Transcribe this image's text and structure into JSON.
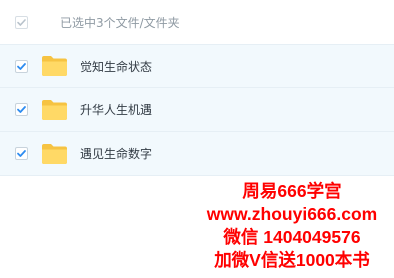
{
  "header": {
    "checked": true,
    "selection_summary": "已选中3个文件/文件夹"
  },
  "items": [
    {
      "label": "觉知生命状态",
      "checked": true,
      "icon": "folder-icon"
    },
    {
      "label": "升华人生机遇",
      "checked": true,
      "icon": "folder-icon"
    },
    {
      "label": "遇见生命数字",
      "checked": true,
      "icon": "folder-icon"
    }
  ],
  "watermark": {
    "line1": "周易666学宫",
    "line2": "www.zhouyi666.com",
    "line3": "微信 1404049576",
    "line4": "加微V信送1000本书"
  },
  "colors": {
    "check": "#2d8cf0",
    "folder": "#ffd55c",
    "row_background": "#f2f9fd",
    "watermark_text": "#ff0000"
  }
}
